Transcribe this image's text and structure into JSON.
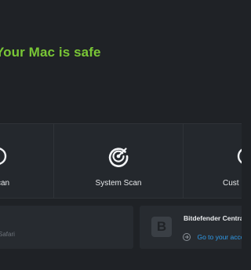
{
  "status": {
    "title": "Your Mac is safe",
    "title_color": "#79c636"
  },
  "scans": [
    {
      "label": "Quick Scan",
      "visible_label": "can",
      "icon": "quick-scan-icon"
    },
    {
      "label": "System Scan",
      "visible_label": "System Scan",
      "icon": "system-scan-icon"
    },
    {
      "label": "Custom Scan",
      "visible_label": "Cust",
      "icon": "custom-scan-icon"
    }
  ],
  "cards": {
    "left": {
      "subtitle": "Safari"
    },
    "central": {
      "logo_letter": "B",
      "title": "Bitdefender Centra",
      "link": "Go to your acco",
      "link_color": "#2f9be9"
    }
  }
}
